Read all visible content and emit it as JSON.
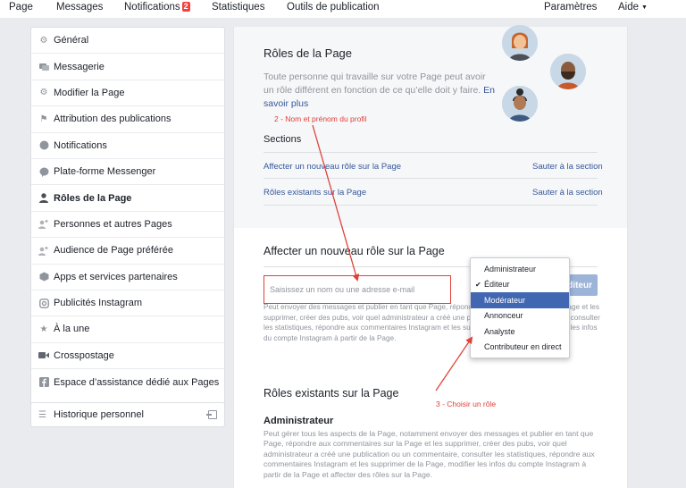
{
  "topnav": {
    "page": "Page",
    "messages": "Messages",
    "notifications": "Notifications",
    "notifications_count": "2",
    "statistics": "Statistiques",
    "publishing_tools": "Outils de publication",
    "settings": "Paramètres",
    "help": "Aide"
  },
  "sidebar": {
    "items": [
      {
        "label": "Général",
        "icon": "gear-icon"
      },
      {
        "label": "Messagerie",
        "icon": "chat-icon"
      },
      {
        "label": "Modifier la Page",
        "icon": "gear-icon"
      },
      {
        "label": "Attribution des publications",
        "icon": "flag-icon"
      },
      {
        "label": "Notifications",
        "icon": "globe-icon"
      },
      {
        "label": "Plate-forme Messenger",
        "icon": "messenger-icon"
      },
      {
        "label": "Rôles de la Page",
        "icon": "person-icon"
      },
      {
        "label": "Personnes et autres Pages",
        "icon": "people-icon"
      },
      {
        "label": "Audience de Page préférée",
        "icon": "people-icon"
      },
      {
        "label": "Apps et services partenaires",
        "icon": "cube-icon"
      },
      {
        "label": "Publicités Instagram",
        "icon": "instagram-icon"
      },
      {
        "label": "À la une",
        "icon": "star-icon"
      },
      {
        "label": "Crosspostage",
        "icon": "video-icon"
      },
      {
        "label": "Espace d’assistance dédié aux Pages",
        "icon": "facebook-icon"
      }
    ],
    "history": "Historique personnel"
  },
  "roles": {
    "title": "Rôles de la Page",
    "description": "Toute personne qui travaille sur votre Page peut avoir un rôle différent en fonction de ce qu’elle doit y faire.",
    "learn_more": "En savoir plus",
    "sections_label": "Sections",
    "section_links": [
      {
        "label": "Affecter un nouveau rôle sur la Page",
        "action": "Sauter à la section"
      },
      {
        "label": "Rôles existants sur la Page",
        "action": "Sauter à la section"
      }
    ]
  },
  "assign": {
    "title": "Affecter un nouveau rôle sur la Page",
    "input_placeholder": "Saisissez un nom ou une adresse e-mail",
    "button_label": "Éditeur",
    "description": "Peut envoyer des messages et publier en tant que Page, répondre aux commentaires sur la Page et les supprimer, créer des pubs, voir quel administrateur a créé une publication ou un commentaire, consulter les statistiques, répondre aux commentaires Instagram et les supprimer de la Page et modifier les infos du compte Instagram à partir de la Page."
  },
  "dropdown": {
    "options": [
      "Administrateur",
      "Éditeur",
      "Modérateur",
      "Annonceur",
      "Analyste",
      "Contributeur en direct"
    ],
    "checked": "Éditeur",
    "highlighted": "Modérateur"
  },
  "existing": {
    "title": "Rôles existants sur la Page",
    "admin_heading": "Administrateur",
    "admin_description": "Peut gérer tous les aspects de la Page, notamment envoyer des messages et publier en tant que Page, répondre aux commentaires sur la Page et les supprimer, créer des pubs, voir quel administrateur a créé une publication ou un commentaire, consulter les statistiques, répondre aux commentaires Instagram et les supprimer de la Page, modifier les infos du compte Instagram à partir de la Page et affecter des rôles sur la Page."
  },
  "annotations": {
    "step2": "2 - Nom et prénom du profil",
    "step3": "3 - Choisir un rôle"
  },
  "colors": {
    "link": "#365899",
    "annotation": "#e0403a",
    "selected": "#4267b2"
  }
}
